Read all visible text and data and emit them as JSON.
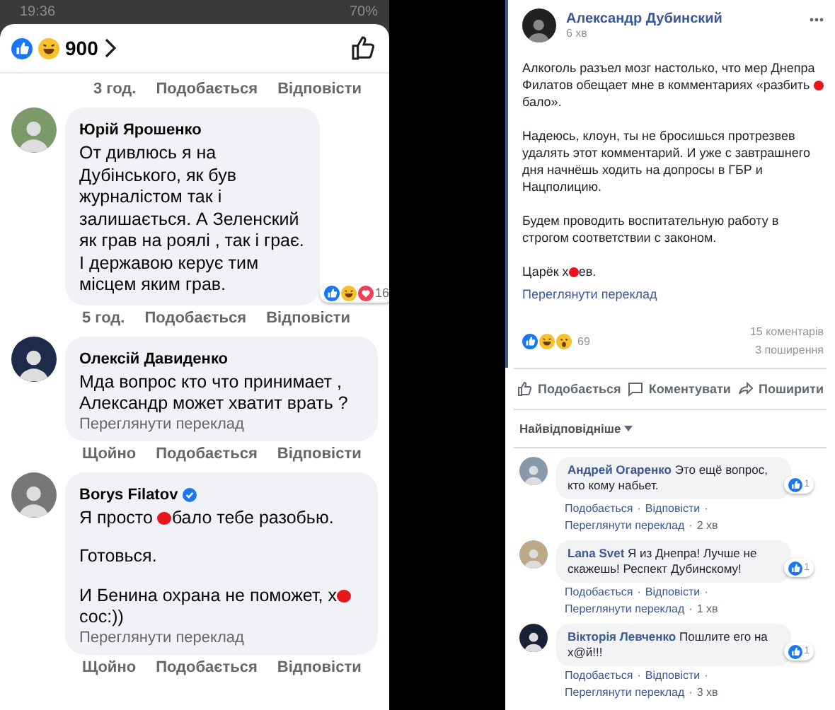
{
  "phone": {
    "status_bar": {
      "time": "19:36",
      "battery": "70%"
    },
    "reactions_header": {
      "count": "900"
    },
    "comments": [
      {
        "kind": "meta_only",
        "meta": [
          "3 год.",
          "Подобається",
          "Відповісти"
        ]
      },
      {
        "kind": "comment",
        "author": "Юрій Ярошенко",
        "verified": false,
        "paragraphs": [
          [
            {
              "kind": "text",
              "text": "От  дивлюсь  я на Дубінського, як  був журналістом  так  і залишається. А Зеленский  як грав  на роялі , так і  грає.    І державою керує тим місцем яким  грав."
            }
          ]
        ],
        "reaction_count": "16",
        "meta": [
          "5 год.",
          "Подобається",
          "Відповісти"
        ]
      },
      {
        "kind": "comment",
        "author": "Олексій Давиденко",
        "verified": false,
        "paragraphs": [
          [
            {
              "kind": "text",
              "text": "Мда вопрос кто что принимает , Александр может хватит врать ?"
            }
          ]
        ],
        "translate": "Переглянути переклад",
        "meta": [
          "Щойно",
          "Подобається",
          "Відповісти"
        ]
      },
      {
        "kind": "comment",
        "author": "Borys Filatov",
        "verified": true,
        "paragraphs": [
          [
            {
              "kind": "text",
              "text": "Я просто "
            },
            {
              "kind": "redaction"
            },
            {
              "kind": "text",
              "text": "бало тебе разобью."
            }
          ],
          [
            {
              "kind": "text",
              "text": "Готовься."
            }
          ],
          [
            {
              "kind": "text",
              "text": "И Бенина охрана не поможет, х"
            },
            {
              "kind": "redaction"
            },
            {
              "kind": "text",
              "text": "сос:))"
            }
          ]
        ],
        "translate": "Переглянути переклад",
        "meta": [
          "Щойно",
          "Подобається",
          "Відповісти"
        ]
      }
    ]
  },
  "post": {
    "author": "Александр Дубинский",
    "time": "6 хв",
    "paragraphs": [
      [
        {
          "kind": "text",
          "text": "Алкоголь разъел мозг настолько, что мер Днепра Филатов обещает мне в комментариях «разбить "
        },
        {
          "kind": "redaction"
        },
        {
          "kind": "text",
          "text": "бало»."
        }
      ],
      [
        {
          "kind": "text",
          "text": "Надеюсь, клоун, ты не бросишься протрезвев удалять этот комментарий. И уже с завтрашнего дня начнёшь ходить на допросы в ГБР и Нацполицию."
        }
      ],
      [
        {
          "kind": "text",
          "text": "Будем проводить воспитательную работу в строгом соответствии с законом."
        }
      ],
      [
        {
          "kind": "text",
          "text": "Царёк х"
        },
        {
          "kind": "redaction"
        },
        {
          "kind": "text",
          "text": "ев."
        }
      ]
    ],
    "translate": "Переглянути переклад",
    "reaction_count": "69",
    "comments_count": "15 коментарів",
    "shares": "3 поширення",
    "actions": [
      {
        "kind": "like",
        "label": "Подобається"
      },
      {
        "kind": "comment",
        "label": "Коментувати"
      },
      {
        "kind": "share",
        "label": "Поширити"
      }
    ],
    "sort": "Найвідповідніше",
    "separator": "·",
    "comments": [
      {
        "author": "Андрей Огаренко",
        "text": "Это ещё вопрос, кто кому набьет.",
        "likes": "1",
        "links": [
          "Подобається",
          "Відповісти",
          "Переглянути переклад"
        ],
        "time": "2 хв"
      },
      {
        "author": "Lana Svet",
        "text": "Я из Днепра! Лучше не скажешь! Респект Дубинскому!",
        "likes": "1",
        "links": [
          "Подобається",
          "Відповісти",
          "Переглянути переклад"
        ],
        "time": "1 хв"
      },
      {
        "author": "Вікторія Левченко",
        "text": "Пошлите его на х@й!!!",
        "likes": "1",
        "links": [
          "Подобається",
          "Відповісти",
          "Переглянути переклад"
        ],
        "time": "3 хв"
      }
    ]
  }
}
